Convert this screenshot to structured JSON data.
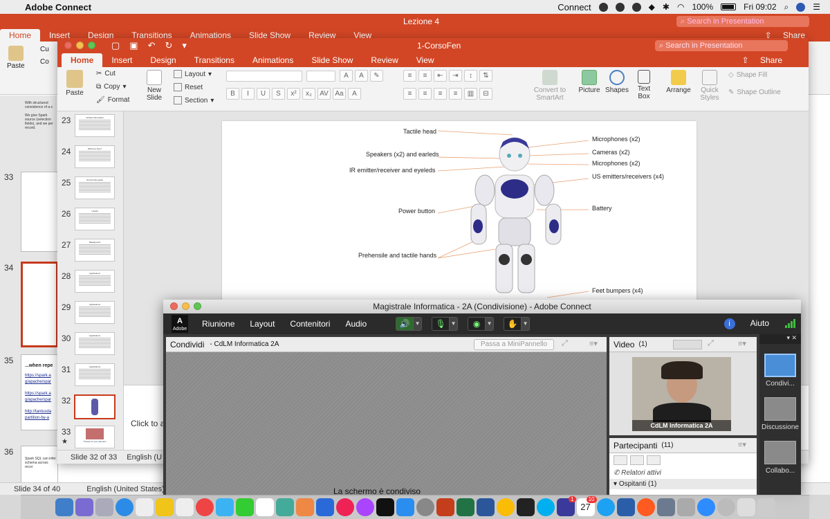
{
  "menubar": {
    "app": "Adobe Connect",
    "status_app": "Connect",
    "battery": "100%",
    "datetime": "Fri 09:02"
  },
  "back_window": {
    "title": "Lezione 4",
    "search_placeholder": "Search in Presentation",
    "share": "Share",
    "tabs": [
      "Home",
      "Insert",
      "Design",
      "Transitions",
      "Animations",
      "Slide Show",
      "Review",
      "View"
    ],
    "ribbon": {
      "paste": "Paste",
      "cut": "Cu",
      "copy": "Co"
    },
    "slide_numbers": [
      "33",
      "34",
      "35",
      "36"
    ],
    "slide_text": {
      "a": "With structured consistence of a s",
      "b": "We give Spark source (selection fields), and we per record.",
      "s35_heading": "...when repe",
      "s35_link1": "https://spark.a g/apache/spar",
      "s35_link2": "https://spark.a g/apache/spar",
      "s35_link3": "http://tantusda partition-by-a",
      "s36": "Spark SQL can infer schema across recor"
    },
    "status": {
      "slide": "Slide 34 of 40",
      "lang": "English (United States)"
    }
  },
  "front_window": {
    "title": "1-CorsoFen",
    "search_placeholder": "Search in Presentation",
    "share": "Share",
    "tabs": [
      "Home",
      "Insert",
      "Design",
      "Transitions",
      "Animations",
      "Slide Show",
      "Review",
      "View"
    ],
    "ribbon": {
      "paste": "Paste",
      "cut": "Cut",
      "copy": "Copy",
      "format": "Format",
      "new_slide": "New Slide",
      "layout": "Layout",
      "reset": "Reset",
      "section": "Section",
      "convert": "Convert to SmartArt",
      "picture": "Picture",
      "shapes": "Shapes",
      "text_box": "Text Box",
      "arrange": "Arrange",
      "quick_styles": "Quick Styles",
      "shape_fill": "Shape Fill",
      "shape_outline": "Shape Outline"
    },
    "slides": [
      {
        "num": "23",
        "title": "Verified Information"
      },
      {
        "num": "24",
        "title": "What are they?"
      },
      {
        "num": "25",
        "title": "Set the files guide"
      },
      {
        "num": "26",
        "title": "Usefull"
      },
      {
        "num": "27",
        "title": "Background"
      },
      {
        "num": "28",
        "title": "Applications"
      },
      {
        "num": "29",
        "title": "Applications"
      },
      {
        "num": "30",
        "title": "Applications"
      },
      {
        "num": "31",
        "title": "Applications"
      },
      {
        "num": "32",
        "title": ""
      },
      {
        "num": "33",
        "title": "Thanks for your attention"
      }
    ],
    "robot_labels": {
      "tactile_head": "Tactile head",
      "speakers": "Speakers (x2) and earleds",
      "ir": "IR emitter/receiver and eyeleds",
      "power": "Power button",
      "hands": "Prehensile and tactile hands",
      "mic1": "Microphones (x2)",
      "cameras": "Cameras (x2)",
      "mic2": "Microphones (x2)",
      "us": "US emitters/receivers (x4)",
      "battery": "Battery",
      "feet": "Feet bumpers (x4)"
    },
    "notes": "Click to ad",
    "status": {
      "slide": "Slide 32 of 33",
      "lang": "English (U"
    }
  },
  "connect": {
    "title": "Magistrale Informatica - 2A (Condivisione) - Adobe Connect",
    "logo": "Adobe",
    "menu": [
      "Riunione",
      "Layout",
      "Contenitori",
      "Audio"
    ],
    "help": "Aiuto",
    "share_pod": {
      "title": "Condividi",
      "subtitle": "- CdLM Informatica 2A",
      "mini": "Passa a MiniPannello"
    },
    "video_pod": {
      "title": "Video",
      "count": "(1)",
      "caption": "CdLM Informatica 2A"
    },
    "participants_pod": {
      "title": "Partecipanti",
      "count": "(11)",
      "active": "Relatori attivi",
      "guests": "Ospitanti (1)"
    },
    "layouts": [
      "Condivi...",
      "Discussione",
      "Collabo..."
    ],
    "overlay_text": "La schermo è condiviso"
  },
  "dock": {
    "calendar_day": "27",
    "badge_ms": "1",
    "badge_cal": "10"
  },
  "colors": {
    "ppt": "#d24625",
    "connect_dark": "#2b2b2b",
    "accent": "#4a8ed8"
  }
}
